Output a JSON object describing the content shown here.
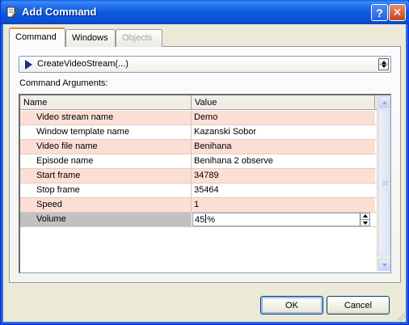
{
  "window": {
    "title": "Add Command",
    "help_label": "?",
    "close_label": "✕",
    "title_icon": "edit-document-icon",
    "accent_color": "#0a58e0"
  },
  "tabs": [
    {
      "label": "Command",
      "state": "active"
    },
    {
      "label": "Windows",
      "state": "normal"
    },
    {
      "label": "Objects",
      "state": "disabled"
    }
  ],
  "command": {
    "selected": "CreateVideoStream(...)",
    "icon": "play-icon"
  },
  "arguments": {
    "label": "Command Arguments:",
    "columns": [
      "Name",
      "Value"
    ],
    "rows": [
      {
        "name": "Video stream name",
        "value": "Demo"
      },
      {
        "name": "Window template name",
        "value": "Kazanski Sobor"
      },
      {
        "name": "Video file name",
        "value": "Benihana"
      },
      {
        "name": "Episode name",
        "value": "Benihana 2 observe"
      },
      {
        "name": "Start frame",
        "value": "34789"
      },
      {
        "name": "Stop frame",
        "value": "35464"
      },
      {
        "name": "Speed",
        "value": "1"
      }
    ],
    "editing_row": {
      "name": "Volume",
      "value": "45",
      "unit": "%"
    }
  },
  "buttons": {
    "ok": "OK",
    "cancel": "Cancel"
  }
}
